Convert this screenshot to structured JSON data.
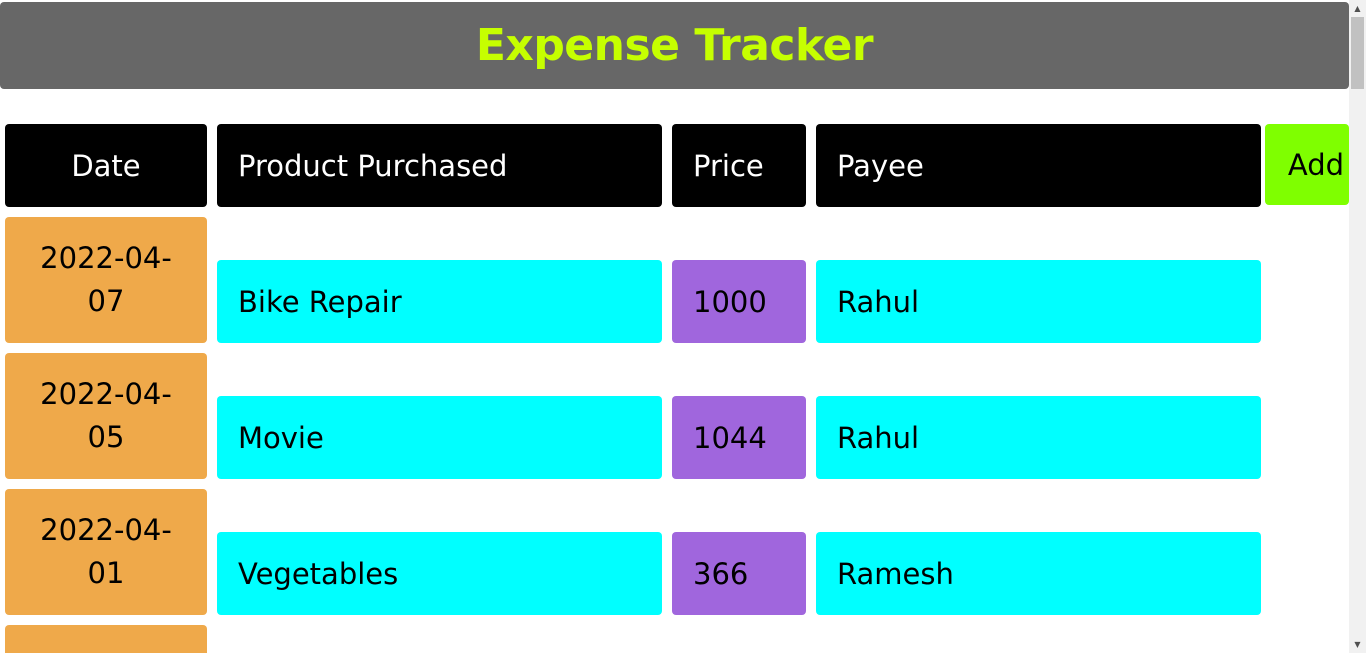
{
  "colors": {
    "header_bg": "#676767",
    "title": "#c6ff00",
    "column_header_bg": "#000000",
    "add_button_bg": "#7fff00",
    "date_bg": "#efa94a",
    "text_cell_bg": "#00ffff",
    "price_bg": "#a066dd"
  },
  "header": {
    "title": "Expense Tracker"
  },
  "table": {
    "columns": [
      "Date",
      "Product Purchased",
      "Price",
      "Payee"
    ],
    "add_label": "Add",
    "rows": [
      {
        "date_line1": "2022-04-",
        "date_line2": "07",
        "product": "Bike Repair",
        "price": "1000",
        "payee": "Rahul"
      },
      {
        "date_line1": "2022-04-",
        "date_line2": "05",
        "product": "Movie",
        "price": "1044",
        "payee": "Rahul"
      },
      {
        "date_line1": "2022-04-",
        "date_line2": "01",
        "product": "Vegetables",
        "price": "366",
        "payee": "Ramesh"
      }
    ]
  },
  "scrollbar": {
    "up_icon": "triangle-up-icon",
    "down_icon": "triangle-down-icon"
  }
}
